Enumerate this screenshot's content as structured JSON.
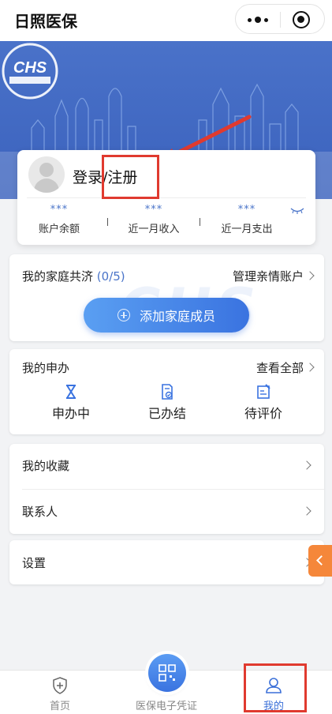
{
  "app": {
    "title": "日照医保"
  },
  "colors": {
    "primary": "#3b62bd",
    "accent": "#4a74c9",
    "annotation": "#e03a2f",
    "side_tab": "#f5873a"
  },
  "account": {
    "login_label": "登录/注册",
    "stats": [
      {
        "value": "***",
        "label": "账户余额"
      },
      {
        "value": "***",
        "label": "近一月收入"
      },
      {
        "value": "***",
        "label": "近一月支出"
      }
    ],
    "toggle_icon": "eye-closed-icon"
  },
  "family": {
    "title": "我的家庭共济",
    "count": "(0/5)",
    "manage_label": "管理亲情账户",
    "add_button": "添加家庭成员"
  },
  "apply": {
    "title": "我的申办",
    "view_all": "查看全部",
    "items": [
      {
        "label": "申办中",
        "icon": "hourglass-icon"
      },
      {
        "label": "已办结",
        "icon": "doc-check-icon"
      },
      {
        "label": "待评价",
        "icon": "doc-edit-icon"
      }
    ]
  },
  "menu": {
    "favorites": "我的收藏",
    "contacts": "联系人",
    "settings": "设置"
  },
  "tabbar": {
    "items": [
      {
        "label": "首页",
        "icon": "shield-plus-icon"
      },
      {
        "label": "医保电子凭证",
        "icon": "qrcode-icon"
      },
      {
        "label": "我的",
        "icon": "user-icon"
      }
    ]
  }
}
